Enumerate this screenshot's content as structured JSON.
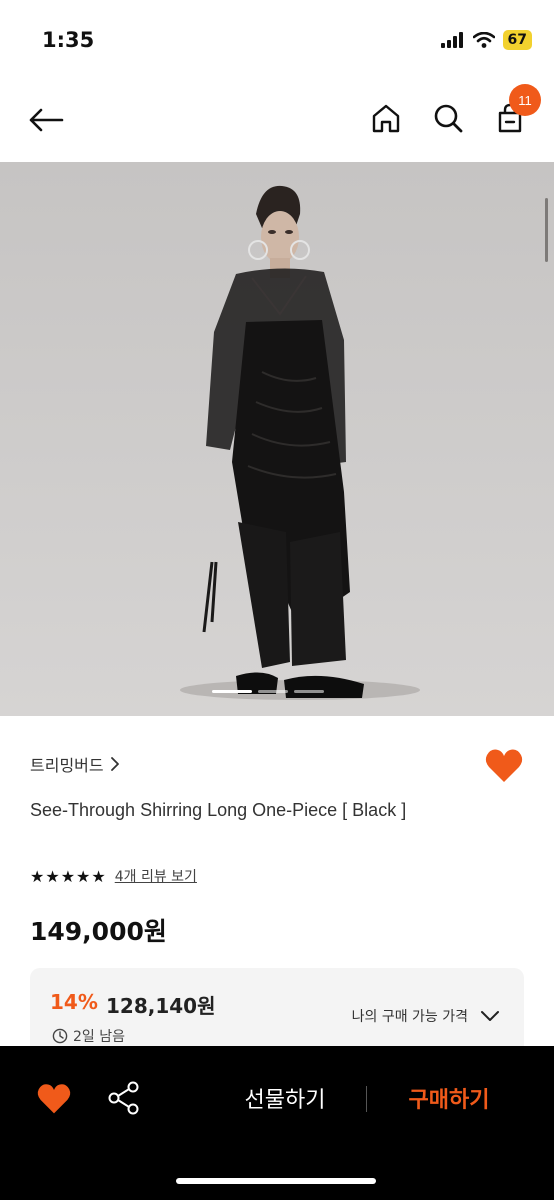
{
  "status_bar": {
    "time": "1:35",
    "battery": "67"
  },
  "nav": {
    "cart_count": "11"
  },
  "product": {
    "brand": "트리밍버드",
    "title": "See-Through Shirring Long One-Piece [ Black ]",
    "stars": "★★★★★",
    "review_link": "4개 리뷰 보기",
    "price": "149,000원"
  },
  "discount": {
    "percent": "14%",
    "price": "128,140원",
    "deadline": "2일 남음",
    "my_price_label": "나의 구매 가능 가격"
  },
  "bottom_bar": {
    "gift_label": "선물하기",
    "buy_label": "구매하기"
  },
  "colors": {
    "accent": "#f05a1a",
    "bottom_bar": "#000000",
    "discount_bg": "#f4f4f4"
  }
}
